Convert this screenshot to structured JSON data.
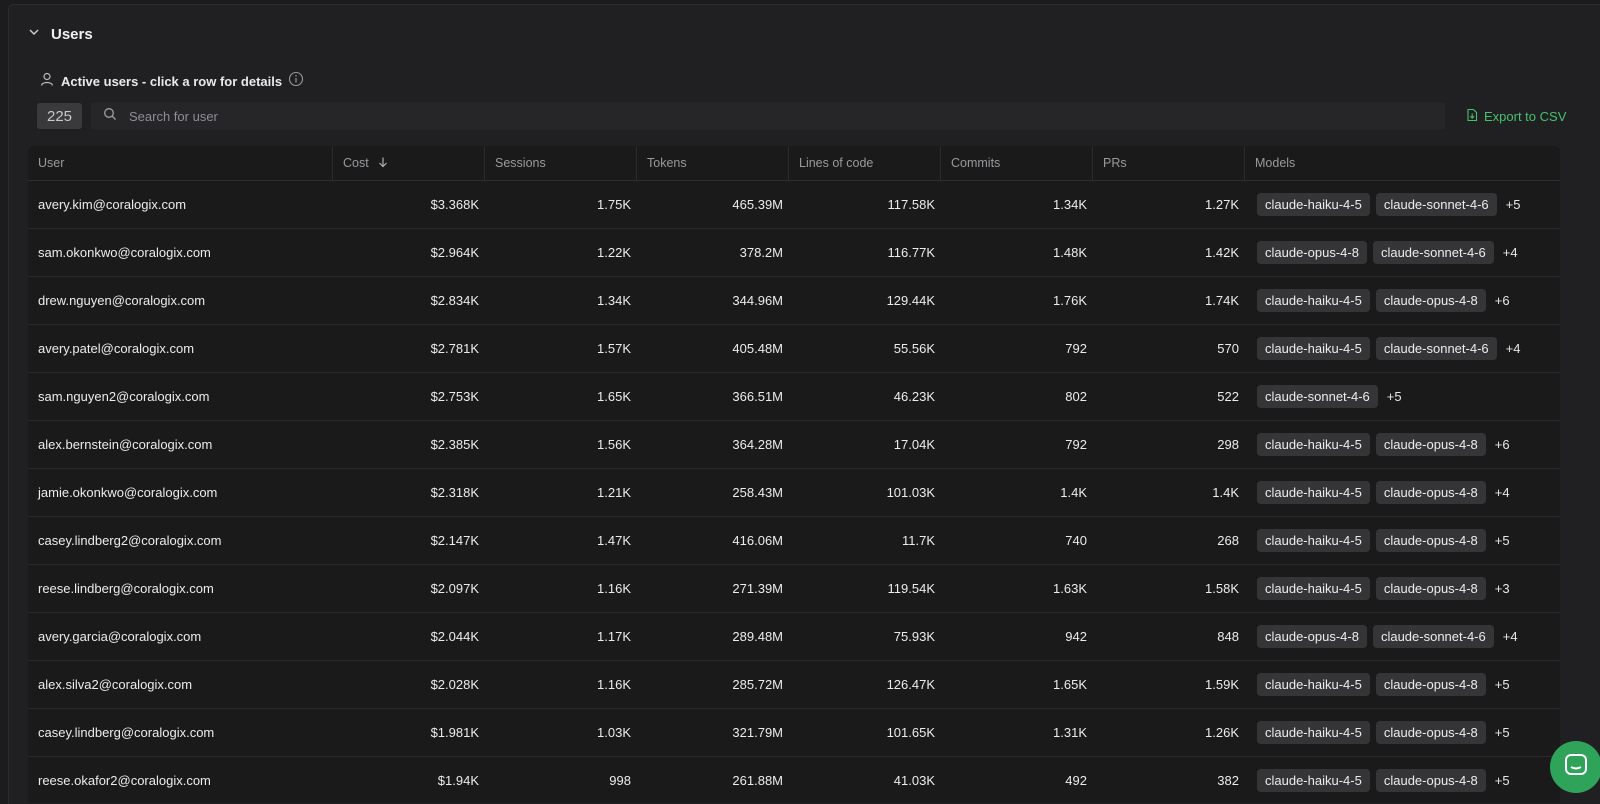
{
  "section": {
    "title": "Users"
  },
  "subheader": {
    "label": "Active users - click a row for details"
  },
  "count": "225",
  "search": {
    "placeholder": "Search for user"
  },
  "export_label": "Export to CSV",
  "columns": [
    "User",
    "Cost",
    "Sessions",
    "Tokens",
    "Lines of code",
    "Commits",
    "PRs",
    "Models"
  ],
  "sort": {
    "column": "Cost",
    "direction": "desc"
  },
  "rows": [
    {
      "user": "avery.kim@coralogix.com",
      "cost": "$3.368K",
      "sessions": "1.75K",
      "tokens": "465.39M",
      "loc": "117.58K",
      "commits": "1.34K",
      "prs": "1.27K",
      "models": [
        "claude-haiku-4-5",
        "claude-sonnet-4-6"
      ],
      "more": "+5"
    },
    {
      "user": "sam.okonkwo@coralogix.com",
      "cost": "$2.964K",
      "sessions": "1.22K",
      "tokens": "378.2M",
      "loc": "116.77K",
      "commits": "1.48K",
      "prs": "1.42K",
      "models": [
        "claude-opus-4-8",
        "claude-sonnet-4-6"
      ],
      "more": "+4"
    },
    {
      "user": "drew.nguyen@coralogix.com",
      "cost": "$2.834K",
      "sessions": "1.34K",
      "tokens": "344.96M",
      "loc": "129.44K",
      "commits": "1.76K",
      "prs": "1.74K",
      "models": [
        "claude-haiku-4-5",
        "claude-opus-4-8"
      ],
      "more": "+6"
    },
    {
      "user": "avery.patel@coralogix.com",
      "cost": "$2.781K",
      "sessions": "1.57K",
      "tokens": "405.48M",
      "loc": "55.56K",
      "commits": "792",
      "prs": "570",
      "models": [
        "claude-haiku-4-5",
        "claude-sonnet-4-6"
      ],
      "more": "+4"
    },
    {
      "user": "sam.nguyen2@coralogix.com",
      "cost": "$2.753K",
      "sessions": "1.65K",
      "tokens": "366.51M",
      "loc": "46.23K",
      "commits": "802",
      "prs": "522",
      "models": [
        "claude-sonnet-4-6"
      ],
      "more": "+5"
    },
    {
      "user": "alex.bernstein@coralogix.com",
      "cost": "$2.385K",
      "sessions": "1.56K",
      "tokens": "364.28M",
      "loc": "17.04K",
      "commits": "792",
      "prs": "298",
      "models": [
        "claude-haiku-4-5",
        "claude-opus-4-8"
      ],
      "more": "+6"
    },
    {
      "user": "jamie.okonkwo@coralogix.com",
      "cost": "$2.318K",
      "sessions": "1.21K",
      "tokens": "258.43M",
      "loc": "101.03K",
      "commits": "1.4K",
      "prs": "1.4K",
      "models": [
        "claude-haiku-4-5",
        "claude-opus-4-8"
      ],
      "more": "+4"
    },
    {
      "user": "casey.lindberg2@coralogix.com",
      "cost": "$2.147K",
      "sessions": "1.47K",
      "tokens": "416.06M",
      "loc": "11.7K",
      "commits": "740",
      "prs": "268",
      "models": [
        "claude-haiku-4-5",
        "claude-opus-4-8"
      ],
      "more": "+5"
    },
    {
      "user": "reese.lindberg@coralogix.com",
      "cost": "$2.097K",
      "sessions": "1.16K",
      "tokens": "271.39M",
      "loc": "119.54K",
      "commits": "1.63K",
      "prs": "1.58K",
      "models": [
        "claude-haiku-4-5",
        "claude-opus-4-8"
      ],
      "more": "+3"
    },
    {
      "user": "avery.garcia@coralogix.com",
      "cost": "$2.044K",
      "sessions": "1.17K",
      "tokens": "289.48M",
      "loc": "75.93K",
      "commits": "942",
      "prs": "848",
      "models": [
        "claude-opus-4-8",
        "claude-sonnet-4-6"
      ],
      "more": "+4"
    },
    {
      "user": "alex.silva2@coralogix.com",
      "cost": "$2.028K",
      "sessions": "1.16K",
      "tokens": "285.72M",
      "loc": "126.47K",
      "commits": "1.65K",
      "prs": "1.59K",
      "models": [
        "claude-haiku-4-5",
        "claude-opus-4-8"
      ],
      "more": "+5"
    },
    {
      "user": "casey.lindberg@coralogix.com",
      "cost": "$1.981K",
      "sessions": "1.03K",
      "tokens": "321.79M",
      "loc": "101.65K",
      "commits": "1.31K",
      "prs": "1.26K",
      "models": [
        "claude-haiku-4-5",
        "claude-opus-4-8"
      ],
      "more": "+5"
    },
    {
      "user": "reese.okafor2@coralogix.com",
      "cost": "$1.94K",
      "sessions": "998",
      "tokens": "261.88M",
      "loc": "41.03K",
      "commits": "492",
      "prs": "382",
      "models": [
        "claude-haiku-4-5",
        "claude-opus-4-8"
      ],
      "more": "+5"
    }
  ],
  "colors": {
    "accent_green": "#45c26b",
    "fab_green": "#2fa35a"
  },
  "icons": [
    "chevron-down-icon",
    "user-icon",
    "info-icon",
    "search-icon",
    "file-download-icon",
    "sort-down-icon",
    "chat-icon"
  ]
}
